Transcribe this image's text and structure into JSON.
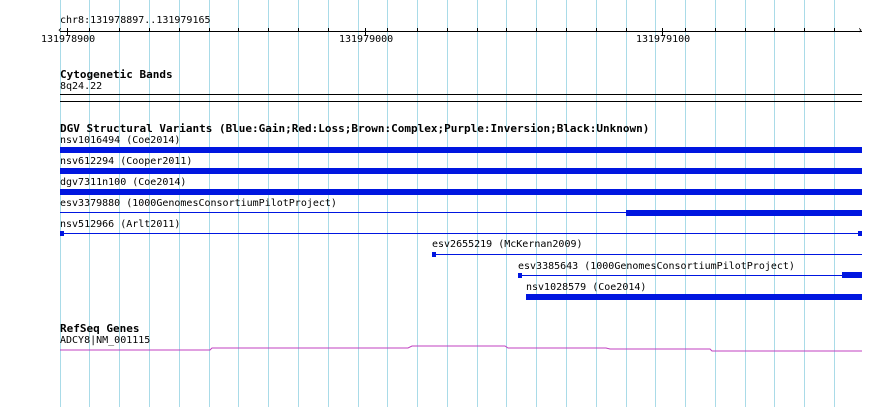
{
  "ruler": {
    "location": "chr8:131978897..131979165",
    "ticks": [
      "131978900",
      "131979000",
      "131979100"
    ]
  },
  "tracks": {
    "cytoband": {
      "title": "Cytogenetic Bands",
      "band": "8q24.22"
    },
    "dgv": {
      "title": "DGV Structural Variants (Blue:Gain;Red:Loss;Brown:Complex;Purple:Inversion;Black:Unknown)",
      "features": [
        {
          "label": "nsv1016494 (Coe2014)"
        },
        {
          "label": "nsv612294 (Cooper2011)"
        },
        {
          "label": "dgv7311n100 (Coe2014)"
        },
        {
          "label": "esv3379880 (1000GenomesConsortiumPilotProject)"
        },
        {
          "label": "nsv512966 (Arlt2011)"
        },
        {
          "label": "esv2655219 (McKernan2009)"
        },
        {
          "label": "esv3385643 (1000GenomesConsortiumPilotProject)"
        },
        {
          "label": "nsv1028579 (Coe2014)"
        }
      ]
    },
    "refseq": {
      "title": "RefSeq Genes",
      "gene": "ADCY8|NM_001115"
    }
  },
  "colors": {
    "gain": "#0016e0",
    "gene": "#c040c0",
    "grid": "#a9dbe8"
  }
}
